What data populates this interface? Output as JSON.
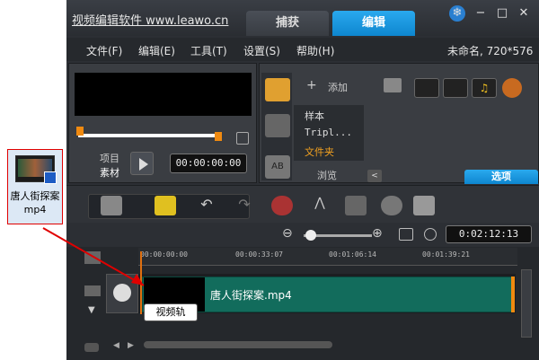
{
  "desktop_file": {
    "name_line1": "唐人街探案",
    "name_line2": "mp4"
  },
  "app": {
    "title": "视频编辑软件 www.leawo.cn",
    "tabs": [
      "捕获",
      "编辑"
    ],
    "window_icons": [
      "snowflake-icon",
      "minimize-icon",
      "maximize-icon",
      "close-icon"
    ],
    "menu": [
      "文件(F)",
      "编辑(E)",
      "工具(T)",
      "设置(S)",
      "帮助(H)"
    ],
    "project_info": "未命名, 720*576"
  },
  "player": {
    "mode_project": "项目",
    "mode_clip": "素材",
    "timecode": "00:00:00:00"
  },
  "library": {
    "add_label": "添加",
    "items": [
      "样本",
      "Tripl...",
      "文件夹"
    ],
    "browse_label": "浏览",
    "options_label": "选项"
  },
  "toolbar": {
    "duration": "0:02:12:13"
  },
  "timeline": {
    "ticks": [
      "00:00:00:00",
      "00:00:33:07",
      "00:01:06:14",
      "00:01:39:21"
    ],
    "clip_name": "唐人街探案.mp4",
    "tooltip": "视频轨"
  },
  "colors": {
    "accent": "#1497e0",
    "clip": "#126c5c",
    "playhead": "#e07010",
    "callout": "#e00000"
  }
}
